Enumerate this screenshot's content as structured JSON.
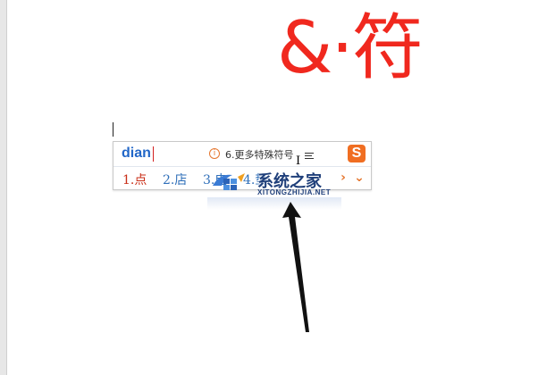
{
  "document": {
    "big_text": "&·符"
  },
  "ime": {
    "pinyin": "dian",
    "hint_icon": "info-circle-icon",
    "hint_text": "6.更多特殊符号",
    "logo_letter": "S",
    "candidates": [
      {
        "label": "1.点"
      },
      {
        "label": "2.店"
      },
      {
        "label": "3.电"
      },
      {
        "label": "4.垫"
      }
    ],
    "next_page_icon": "chevron-right-icon",
    "expand_icon": "chevron-down-icon",
    "accent_color": "#2f6fb9",
    "highlight_color": "#c92e17"
  },
  "watermark": {
    "name": "系统之家",
    "domain": "XITONGZHIJIA.NET"
  },
  "annotation": {
    "arrow": "pointing-arrow"
  }
}
